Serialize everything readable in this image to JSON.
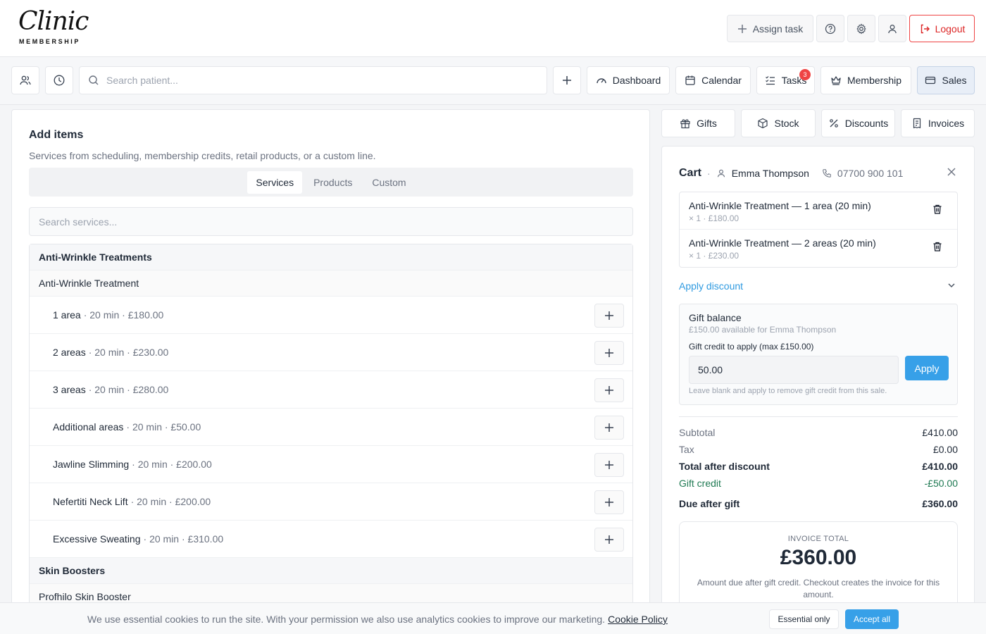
{
  "header": {
    "logo_script": "Clinic",
    "logo_sub": "MEMBERSHIP",
    "assign_task_label": "Assign task",
    "logout_label": "Logout"
  },
  "nav": {
    "search_placeholder": "Search patient...",
    "dashboard_label": "Dashboard",
    "calendar_label": "Calendar",
    "tasks_label": "Tasks",
    "tasks_badge": "3",
    "membership_label": "Membership",
    "sales_label": "Sales"
  },
  "add_items": {
    "title": "Add items",
    "subtitle": "Services from scheduling, membership credits, retail products, or a custom line.",
    "tabs": [
      "Services",
      "Products",
      "Custom"
    ],
    "search_placeholder": "Search services...",
    "group1": "Anti-Wrinkle Treatments",
    "subgroup1": "Anti-Wrinkle Treatment",
    "services": [
      {
        "name": "1 area",
        "meta": "· 20 min · £180.00"
      },
      {
        "name": "2 areas",
        "meta": "· 20 min · £230.00"
      },
      {
        "name": "3 areas",
        "meta": "· 20 min · £280.00"
      },
      {
        "name": "Additional areas",
        "meta": "· 20 min · £50.00"
      },
      {
        "name": "Jawline Slimming",
        "meta": "· 20 min · £200.00"
      },
      {
        "name": "Nefertiti Neck Lift",
        "meta": "· 20 min · £200.00"
      },
      {
        "name": "Excessive Sweating",
        "meta": "· 20 min · £310.00"
      }
    ],
    "group2": "Skin Boosters",
    "subgroup2": "Profhilo Skin Booster"
  },
  "right_tabs": {
    "gifts": "Gifts",
    "stock": "Stock",
    "discounts": "Discounts",
    "invoices": "Invoices"
  },
  "cart": {
    "title": "Cart",
    "dot": "·",
    "patient": "Emma Thompson",
    "phone": "07700 900 101",
    "items": [
      {
        "name": "Anti-Wrinkle Treatment — 1 area (20 min)",
        "meta": "× 1 · £180.00"
      },
      {
        "name": "Anti-Wrinkle Treatment — 2 areas (20 min)",
        "meta": "× 1 · £230.00"
      }
    ],
    "apply_discount": "Apply discount",
    "gift": {
      "title": "Gift balance",
      "available": "£150.00 available for Emma Thompson",
      "label": "Gift credit to apply (max £150.00)",
      "value": "50.00",
      "apply": "Apply",
      "hint": "Leave blank and apply to remove gift credit from this sale."
    },
    "totals": [
      {
        "label": "Subtotal",
        "value": "£410.00",
        "style": ""
      },
      {
        "label": "Tax",
        "value": "£0.00",
        "style": ""
      },
      {
        "label": "Total after discount",
        "value": "£410.00",
        "style": "bold"
      },
      {
        "label": "Gift credit",
        "value": "-£50.00",
        "style": "green"
      },
      {
        "label": "Due after gift",
        "value": "£360.00",
        "style": "bold"
      }
    ],
    "invoice": {
      "label": "INVOICE TOTAL",
      "amount": "£360.00",
      "note": "Amount due after gift credit. Checkout creates the invoice for this amount."
    }
  },
  "cookie": {
    "text": "We use essential cookies to run the site. With your permission we also use analytics cookies to improve our marketing.",
    "link": "Cookie Policy",
    "essential": "Essential only",
    "accept": "Accept all"
  },
  "colors": {
    "accent": "#37a0e8",
    "danger": "#ef4444",
    "credit_green": "#1f7a53"
  }
}
